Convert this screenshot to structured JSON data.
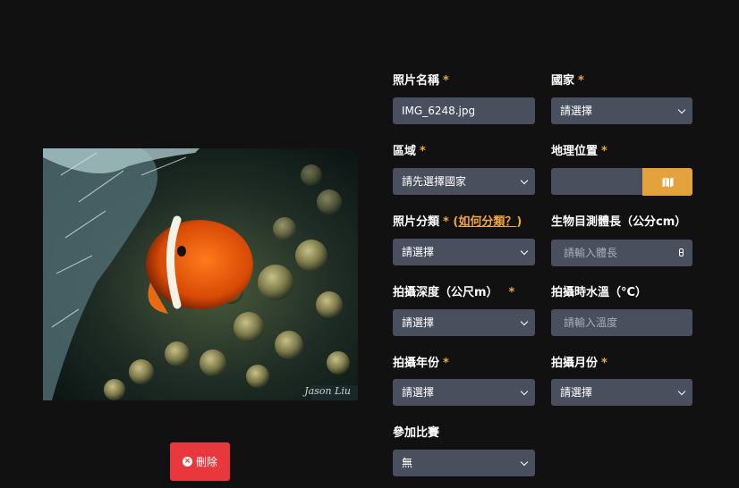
{
  "photo": {
    "signature": "Jason Liu"
  },
  "delete_button": {
    "label": "刪除"
  },
  "form": {
    "photo_name": {
      "label": "照片名稱",
      "required": "*",
      "value": "IMG_6248.jpg"
    },
    "country": {
      "label": "國家",
      "required": "*",
      "value": "請選擇"
    },
    "region": {
      "label": "區域",
      "required": "*",
      "value": "請先選擇國家"
    },
    "location": {
      "label": "地理位置",
      "required": "*",
      "value": ""
    },
    "category": {
      "label": "照片分類",
      "required": "*",
      "help_open": "(",
      "help_link": "如何分類？",
      "help_close": ")",
      "value": "請選擇"
    },
    "body_length": {
      "label": "生物目測體長（公分cm）",
      "placeholder": "請輸入體長"
    },
    "depth": {
      "label": "拍攝深度（公尺m）",
      "required": "*",
      "value": "請選擇"
    },
    "water_temp": {
      "label": "拍攝時水溫（°C）",
      "placeholder": "請輸入溫度"
    },
    "year": {
      "label": "拍攝年份",
      "required": "*",
      "value": "請選擇"
    },
    "month": {
      "label": "拍攝月份",
      "required": "*",
      "value": "請選擇"
    },
    "contest": {
      "label": "參加比賽",
      "value": "無"
    }
  },
  "colors": {
    "background": "#111112",
    "field": "#4a4f5e",
    "accent": "#e3a23b",
    "required": "#f0a63a",
    "danger": "#e9383d"
  },
  "icons": {
    "delete": "x-circle-icon",
    "map": "map-icon",
    "dropdown": "chevron-down-icon"
  }
}
